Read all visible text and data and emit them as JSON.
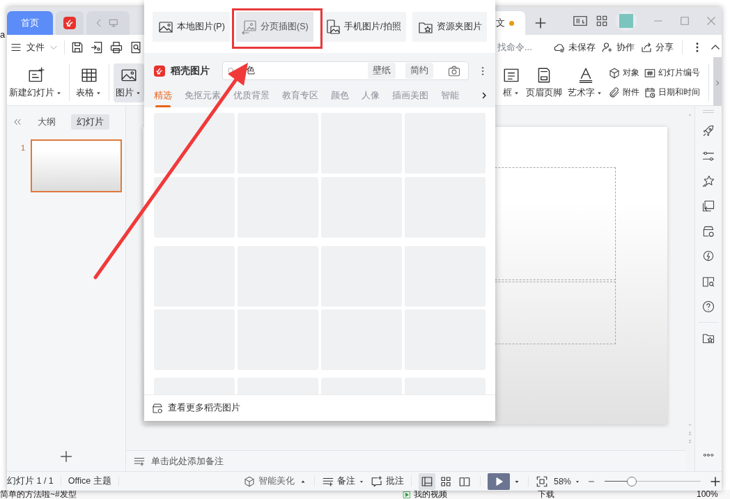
{
  "tabs": [
    {
      "kind": "home",
      "label": "首页",
      "selected": false
    },
    {
      "kind": "logo",
      "selected": false
    },
    {
      "kind": "nav",
      "selected": false
    },
    {
      "kind": "doc",
      "label": "文",
      "modified": true,
      "selected": true
    }
  ],
  "menubar": {
    "file_label": "文件",
    "search_placeholder": "找命令...",
    "actions": [
      "未保存",
      "协作",
      "分享"
    ]
  },
  "ribbon": {
    "left_items": [
      {
        "kind": "large",
        "label": "新建幻灯片",
        "dropdown": true,
        "selected": false
      },
      {
        "kind": "large",
        "label": "表格",
        "dropdown": true,
        "selected": false
      },
      {
        "kind": "large",
        "label": "图片",
        "dropdown": true,
        "selected": true
      }
    ],
    "right_items": [
      {
        "kind": "large",
        "label": "框",
        "dropdown": true,
        "selected": false
      },
      {
        "kind": "large",
        "label": "页眉页脚",
        "dropdown": false,
        "selected": false
      },
      {
        "kind": "large",
        "label": "艺术字",
        "dropdown": true,
        "selected": false
      },
      {
        "kind": "small",
        "label": "对象",
        "selected": false
      },
      {
        "kind": "small",
        "label": "附件",
        "selected": false
      },
      {
        "kind": "small",
        "label": "幻灯片编号",
        "selected": false
      },
      {
        "kind": "small",
        "label": "日期和时间",
        "selected": false
      }
    ]
  },
  "left_pane": {
    "tabs": [
      {
        "label": "大纲",
        "selected": false
      },
      {
        "label": "幻灯片",
        "selected": true
      }
    ],
    "slides": [
      {
        "number": "1",
        "selected": true
      }
    ]
  },
  "notes_placeholder": "单击此处添加备注",
  "status_bar": {
    "slide_info": "幻灯片 1 / 1",
    "theme": "Office 主题",
    "beautify": "智能美化",
    "notes": "备注",
    "comments": "批注",
    "views": [
      {
        "selected": true
      },
      {
        "selected": false
      },
      {
        "selected": false
      }
    ],
    "zoom": "58%",
    "zoom_slider": {
      "level": 0.28
    }
  },
  "picture_menu": {
    "sources": [
      {
        "label": "本地图片(P)",
        "selected": false
      },
      {
        "label": "分页插图(S)",
        "selected": true
      },
      {
        "label": "手机图片/拍照",
        "selected": false
      },
      {
        "label": "资源夹图片",
        "selected": false
      }
    ],
    "brand": "稻壳图片",
    "search_value": "色",
    "chips": [
      "壁纸",
      "简约"
    ],
    "categories": [
      {
        "label": "精选",
        "selected": true
      },
      {
        "label": "免抠元素",
        "selected": false
      },
      {
        "label": "优质背景",
        "selected": false
      },
      {
        "label": "教育专区",
        "selected": false
      },
      {
        "label": "颜色",
        "selected": false
      },
      {
        "label": "人像",
        "selected": false
      },
      {
        "label": "插画美图",
        "selected": false
      },
      {
        "label": "智能",
        "selected": false
      }
    ],
    "more_link": "查看更多稻壳图片"
  },
  "background": {
    "left_text": "a",
    "taskbar": [
      "简单的方法啦~#发型",
      "我的视频",
      "下载",
      "100%"
    ]
  }
}
